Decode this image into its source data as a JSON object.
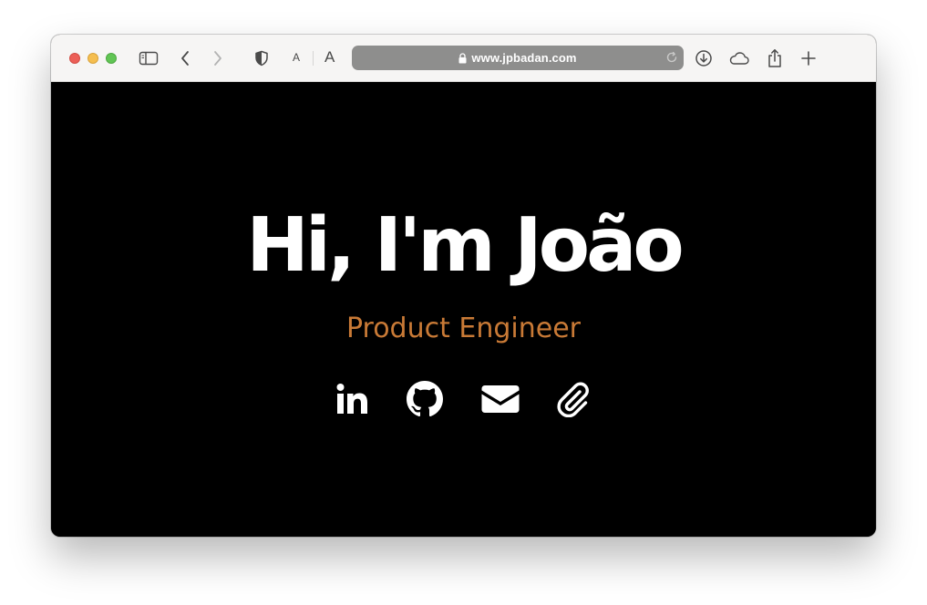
{
  "browser": {
    "url": "www.jpbadan.com",
    "font_small_label": "A",
    "font_large_label": "A"
  },
  "page": {
    "title": "Hi, I'm João",
    "subtitle": "Product Engineer",
    "social_links": [
      {
        "icon": "linkedin-icon"
      },
      {
        "icon": "github-icon"
      },
      {
        "icon": "mail-icon"
      },
      {
        "icon": "paperclip-icon"
      }
    ]
  },
  "colors": {
    "background": "#000000",
    "title": "#ffffff",
    "subtitle": "#c97a36"
  }
}
